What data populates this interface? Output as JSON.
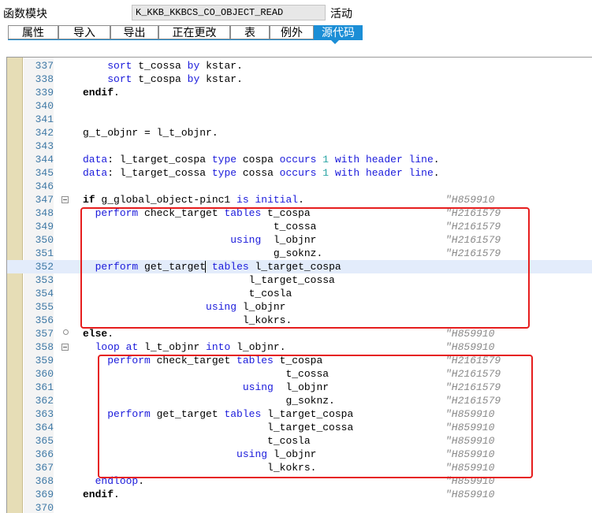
{
  "header": {
    "function_module_label": "函数模块",
    "function_module_name": "K_KKB_KKBCS_CO_OBJECT_READ",
    "status": "活动"
  },
  "tabs": [
    {
      "label": "属性",
      "active": false
    },
    {
      "label": "导入",
      "active": false
    },
    {
      "label": "导出",
      "active": false
    },
    {
      "label": "正在更改",
      "active": false
    },
    {
      "label": "表",
      "active": false
    },
    {
      "label": "例外",
      "active": false
    },
    {
      "label": "源代码",
      "active": true
    }
  ],
  "colors": {
    "accent": "#1b8ed6",
    "keyword": "#1a1adb",
    "number": "#2aa5a5",
    "line_number": "#3f79a6",
    "comment": "#8a8a8a",
    "highlight_box": "#e61e1e",
    "gutter": "#e6ddb6",
    "current_line": "#e3ecfb"
  },
  "editor": {
    "current_line": 352,
    "cursor_after": "perform get_target",
    "lines": [
      {
        "n": "337",
        "code": "    sort t_cossa by kstar.",
        "comment": ""
      },
      {
        "n": "338",
        "code": "    sort t_cospa by kstar.",
        "comment": ""
      },
      {
        "n": "339",
        "code": "endif.",
        "comment": ""
      },
      {
        "n": "340",
        "code": "",
        "comment": ""
      },
      {
        "n": "341",
        "code": "",
        "comment": ""
      },
      {
        "n": "342",
        "code": "g_t_objnr = l_t_objnr.",
        "comment": ""
      },
      {
        "n": "343",
        "code": "",
        "comment": ""
      },
      {
        "n": "344",
        "code": "data: l_target_cospa type cospa occurs 1 with header line.",
        "comment": ""
      },
      {
        "n": "345",
        "code": "data: l_target_cossa type cossa occurs 1 with header line.",
        "comment": ""
      },
      {
        "n": "346",
        "code": "",
        "comment": ""
      },
      {
        "n": "347",
        "code": "if g_global_object-pinc1 is initial.",
        "comment": "\"H859910",
        "fold": "open"
      },
      {
        "n": "348",
        "code": "  perform check_target tables t_cospa",
        "comment": "\"H2161579"
      },
      {
        "n": "349",
        "code": "                               t_cossa",
        "comment": "\"H2161579"
      },
      {
        "n": "350",
        "code": "                        using  l_objnr",
        "comment": "\"H2161579"
      },
      {
        "n": "351",
        "code": "                               g_soknz.",
        "comment": "\"H2161579"
      },
      {
        "n": "352",
        "code": "  perform get_target tables l_target_cospa",
        "comment": ""
      },
      {
        "n": "353",
        "code": "                           l_target_cossa",
        "comment": ""
      },
      {
        "n": "354",
        "code": "                           t_cosla",
        "comment": ""
      },
      {
        "n": "355",
        "code": "                    using l_objnr",
        "comment": ""
      },
      {
        "n": "356",
        "code": "                          l_kokrs.",
        "comment": ""
      },
      {
        "n": "357",
        "code": "else.",
        "comment": "\"H859910",
        "fold": "mid"
      },
      {
        "n": "358",
        "code": "  loop at l_t_objnr into l_objnr.",
        "comment": "\"H859910",
        "fold": "open"
      },
      {
        "n": "359",
        "code": "    perform check_target tables t_cospa",
        "comment": "\"H2161579"
      },
      {
        "n": "360",
        "code": "                                 t_cossa",
        "comment": "\"H2161579"
      },
      {
        "n": "361",
        "code": "                          using  l_objnr",
        "comment": "\"H2161579"
      },
      {
        "n": "362",
        "code": "                                 g_soknz.",
        "comment": "\"H2161579"
      },
      {
        "n": "363",
        "code": "    perform get_target tables l_target_cospa",
        "comment": "\"H859910"
      },
      {
        "n": "364",
        "code": "                              l_target_cossa",
        "comment": "\"H859910"
      },
      {
        "n": "365",
        "code": "                              t_cosla",
        "comment": "\"H859910"
      },
      {
        "n": "366",
        "code": "                         using l_objnr",
        "comment": "\"H859910"
      },
      {
        "n": "367",
        "code": "                              l_kokrs.",
        "comment": "\"H859910"
      },
      {
        "n": "368",
        "code": "  endloop.",
        "comment": "\"H859910"
      },
      {
        "n": "369",
        "code": "endif.",
        "comment": "\"H859910"
      },
      {
        "n": "370",
        "code": "",
        "comment": ""
      }
    ]
  }
}
